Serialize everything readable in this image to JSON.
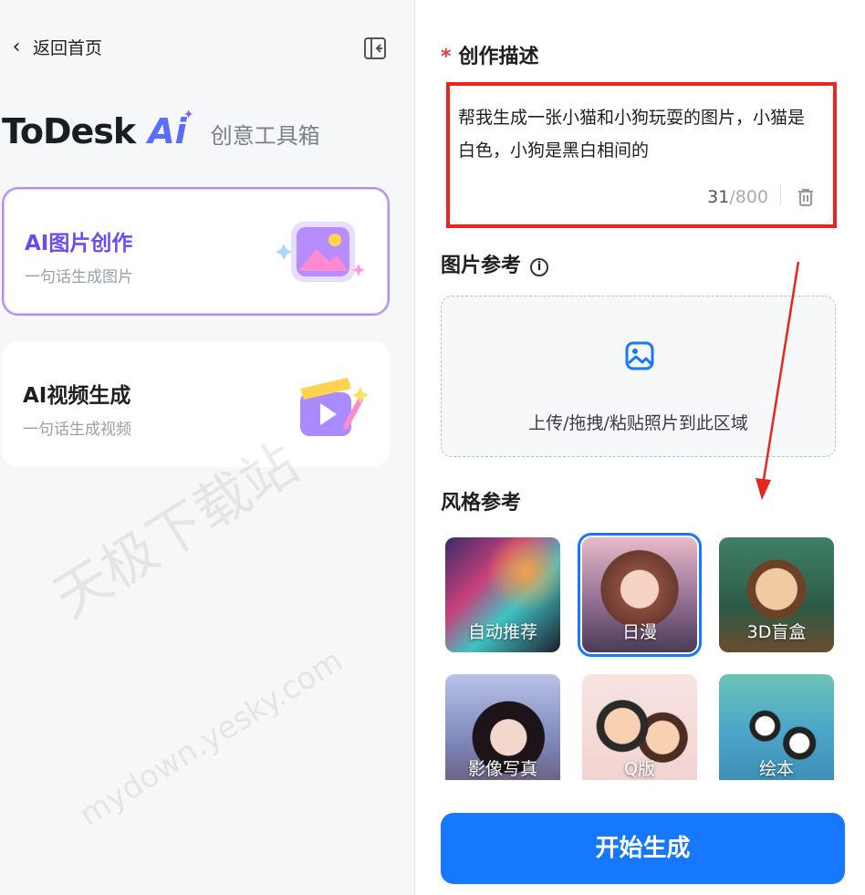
{
  "nav": {
    "back_label": "返回首页"
  },
  "brand": {
    "name": "ToDesk",
    "ai": "Ai",
    "subtitle": "创意工具箱"
  },
  "cards": [
    {
      "title": "AI图片创作",
      "subtitle": "一句话生成图片",
      "active": true
    },
    {
      "title": "AI视频生成",
      "subtitle": "一句话生成视频",
      "active": false
    }
  ],
  "prompt": {
    "required_mark": "*",
    "label": "创作描述",
    "value": "帮我生成一张小猫和小狗玩耍的图片，小猫是白色，小狗是黑白相间的",
    "count": "31",
    "max": "/800"
  },
  "reference": {
    "label": "图片参考",
    "info": "i",
    "upload_text": "上传/拖拽/粘贴照片到此区域"
  },
  "style": {
    "label": "风格参考",
    "items": [
      {
        "label": "自动推荐",
        "selected": false
      },
      {
        "label": "日漫",
        "selected": true
      },
      {
        "label": "3D盲盒",
        "selected": false
      },
      {
        "label": "影像写真",
        "selected": false
      },
      {
        "label": "Q版",
        "selected": false
      },
      {
        "label": "绘本",
        "selected": false
      }
    ]
  },
  "cta": {
    "label": "开始生成"
  },
  "watermark": {
    "text": "天极下载站",
    "url": "mydown.yesky.com"
  },
  "colors": {
    "accent": "#1677ff",
    "annotation": "#e8251f",
    "purple": "#6a4cf0"
  }
}
